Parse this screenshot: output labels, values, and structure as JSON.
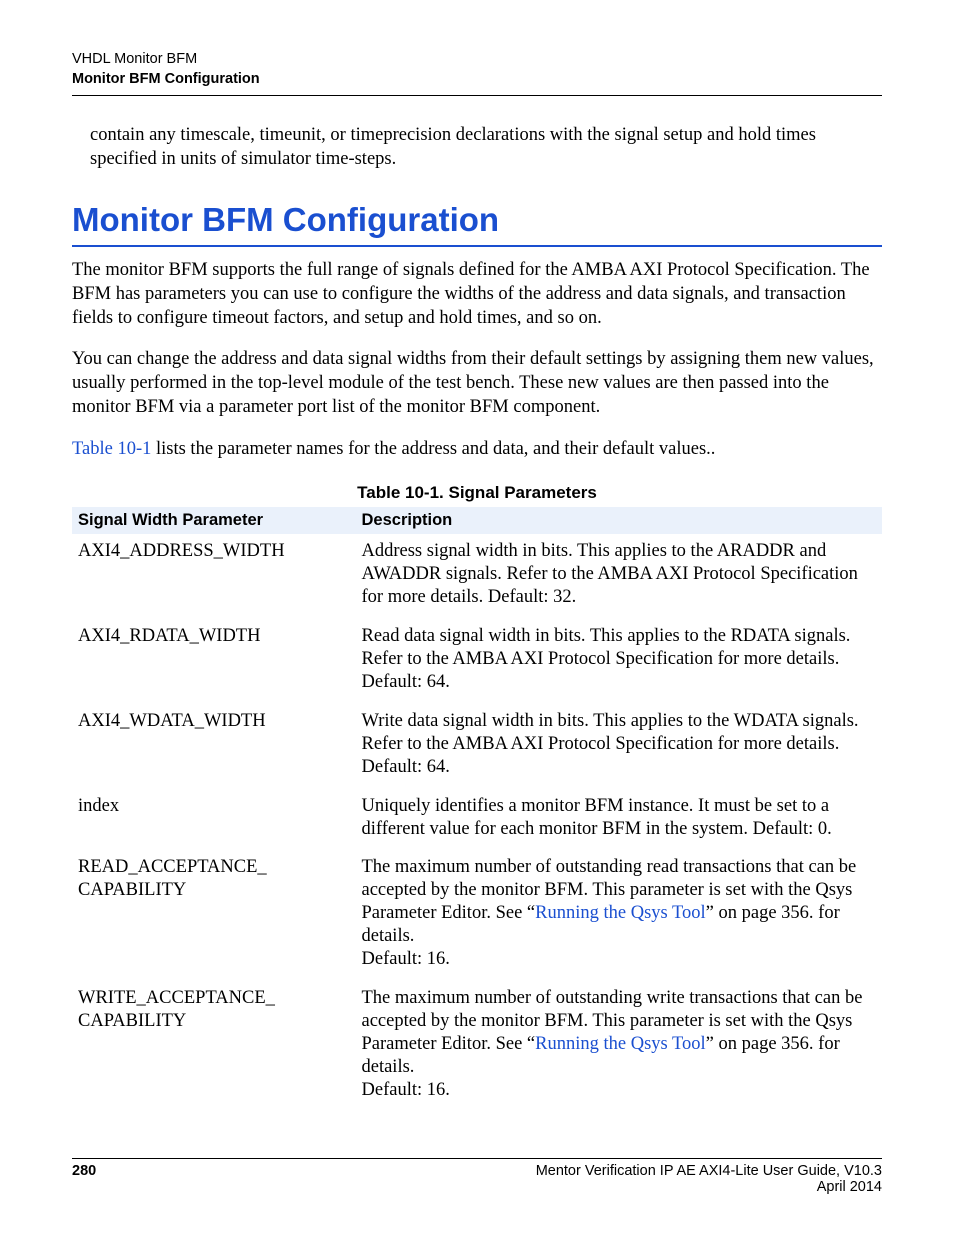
{
  "header": {
    "line1": "VHDL Monitor BFM",
    "line2": "Monitor BFM Configuration"
  },
  "intro_paragraph": "contain any timescale, timeunit, or timeprecision declarations with the signal setup and hold times specified in units of simulator time-steps.",
  "section_title": "Monitor BFM Configuration",
  "para1": "The monitor BFM supports the full range of signals defined for the AMBA AXI Protocol Specification. The BFM has parameters you can use to configure the widths of the address and data signals, and transaction fields to configure timeout factors,  and setup and hold times, and so on.",
  "para2": "You can change the address and data signal widths from their default settings by assigning them new values, usually performed in the top-level module of the test bench. These new values are then passed into the monitor BFM via a parameter port list of the monitor BFM component.",
  "para3_link": "Table 10-1",
  "para3_rest": " lists the parameter names for the address and data, and their default values..",
  "table": {
    "caption": "Table 10-1. Signal Parameters",
    "headers": [
      "Signal Width Parameter",
      "Description"
    ],
    "rows": [
      {
        "name": "AXI4_ADDRESS_WIDTH",
        "desc": "Address signal width in bits. This applies to the ARADDR and AWADDR signals. Refer to the AMBA AXI Protocol Specification for more details. Default: 32."
      },
      {
        "name": "AXI4_RDATA_WIDTH",
        "desc": "Read data signal width in bits. This applies to the RDATA signals. Refer to the AMBA AXI Protocol Specification for more details. Default: 64."
      },
      {
        "name": "AXI4_WDATA_WIDTH",
        "desc": "Write data signal width in bits. This applies to the WDATA signals. Refer to the AMBA AXI Protocol Specification for more details. Default: 64."
      },
      {
        "name": "index",
        "desc": "Uniquely identifies a monitor BFM instance. It must be set to a different value for each monitor BFM in the system. Default: 0."
      },
      {
        "name": "READ_ACCEPTANCE_\nCAPABILITY",
        "desc_pre": "The maximum number of outstanding read transactions that can be accepted by the monitor BFM. This parameter is set with the Qsys Parameter Editor. See “",
        "desc_link": "Running the Qsys Tool",
        "desc_post": "” on page 356. for details.\nDefault: 16."
      },
      {
        "name": "WRITE_ACCEPTANCE_\nCAPABILITY",
        "desc_pre": "The maximum number of outstanding write transactions that can be accepted by the monitor BFM. This parameter is set with the Qsys Parameter Editor. See “",
        "desc_link": "Running the Qsys Tool",
        "desc_post": "” on page 356. for details.\nDefault: 16."
      }
    ]
  },
  "footer": {
    "page": "280",
    "right1": "Mentor Verification IP AE AXI4-Lite User Guide, V10.3",
    "right2": "April 2014"
  }
}
